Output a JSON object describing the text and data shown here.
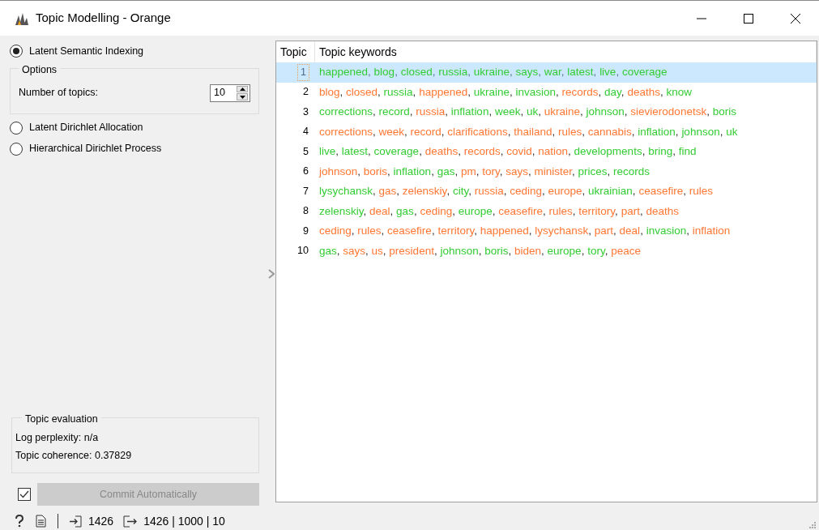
{
  "window": {
    "title": "Topic Modelling - Orange"
  },
  "methods": [
    {
      "label": "Latent Semantic Indexing",
      "selected": true
    },
    {
      "label": "Latent Dirichlet Allocation",
      "selected": false
    },
    {
      "label": "Hierarchical Dirichlet Process",
      "selected": false
    }
  ],
  "options": {
    "title": "Options",
    "label": "Number of topics:",
    "value": "10"
  },
  "evaluation": {
    "title": "Topic evaluation",
    "lines": [
      "Log perplexity: n/a",
      "Topic coherence: 0.37829"
    ]
  },
  "commit": {
    "checked": true,
    "label": "Commit Automatically",
    "disabled": true
  },
  "status_bar": {
    "input": "1426",
    "output": "1426 | 1000 | 10"
  },
  "table": {
    "columns": [
      "Topic",
      "Topic keywords"
    ],
    "separator": ", ",
    "rows": [
      {
        "topic": "1",
        "selected": true,
        "keywords": [
          {
            "text": "happened",
            "color": "#33cc33"
          },
          {
            "text": "blog",
            "color": "#33cc33"
          },
          {
            "text": "closed",
            "color": "#33cc33"
          },
          {
            "text": "russia",
            "color": "#33cc33"
          },
          {
            "text": "ukraine",
            "color": "#33cc33"
          },
          {
            "text": "says",
            "color": "#33cc33"
          },
          {
            "text": "war",
            "color": "#33cc33"
          },
          {
            "text": "latest",
            "color": "#33cc33"
          },
          {
            "text": "live",
            "color": "#33cc33"
          },
          {
            "text": "coverage",
            "color": "#33cc33"
          }
        ]
      },
      {
        "topic": "2",
        "selected": false,
        "keywords": [
          {
            "text": "blog",
            "color": "#ff7733"
          },
          {
            "text": "closed",
            "color": "#ff7733"
          },
          {
            "text": "russia",
            "color": "#33cc33"
          },
          {
            "text": "happened",
            "color": "#ff7733"
          },
          {
            "text": "ukraine",
            "color": "#33cc33"
          },
          {
            "text": "invasion",
            "color": "#33cc33"
          },
          {
            "text": "records",
            "color": "#ff7733"
          },
          {
            "text": "day",
            "color": "#33cc33"
          },
          {
            "text": "deaths",
            "color": "#ff7733"
          },
          {
            "text": "know",
            "color": "#33cc33"
          }
        ]
      },
      {
        "topic": "3",
        "selected": false,
        "keywords": [
          {
            "text": "corrections",
            "color": "#33cc33"
          },
          {
            "text": "record",
            "color": "#33cc33"
          },
          {
            "text": "russia",
            "color": "#ff7733"
          },
          {
            "text": "inflation",
            "color": "#33cc33"
          },
          {
            "text": "week",
            "color": "#33cc33"
          },
          {
            "text": "uk",
            "color": "#33cc33"
          },
          {
            "text": "ukraine",
            "color": "#ff7733"
          },
          {
            "text": "johnson",
            "color": "#33cc33"
          },
          {
            "text": "sievierodonetsk",
            "color": "#ff7733"
          },
          {
            "text": "boris",
            "color": "#33cc33"
          }
        ]
      },
      {
        "topic": "4",
        "selected": false,
        "keywords": [
          {
            "text": "corrections",
            "color": "#ff7733"
          },
          {
            "text": "week",
            "color": "#ff7733"
          },
          {
            "text": "record",
            "color": "#ff7733"
          },
          {
            "text": "clarifications",
            "color": "#ff7733"
          },
          {
            "text": "thailand",
            "color": "#ff7733"
          },
          {
            "text": "rules",
            "color": "#ff7733"
          },
          {
            "text": "cannabis",
            "color": "#ff7733"
          },
          {
            "text": "inflation",
            "color": "#33cc33"
          },
          {
            "text": "johnson",
            "color": "#33cc33"
          },
          {
            "text": "uk",
            "color": "#33cc33"
          }
        ]
      },
      {
        "topic": "5",
        "selected": false,
        "keywords": [
          {
            "text": "live",
            "color": "#33cc33"
          },
          {
            "text": "latest",
            "color": "#33cc33"
          },
          {
            "text": "coverage",
            "color": "#33cc33"
          },
          {
            "text": "deaths",
            "color": "#ff7733"
          },
          {
            "text": "records",
            "color": "#ff7733"
          },
          {
            "text": "covid",
            "color": "#ff7733"
          },
          {
            "text": "nation",
            "color": "#ff7733"
          },
          {
            "text": "developments",
            "color": "#33cc33"
          },
          {
            "text": "bring",
            "color": "#33cc33"
          },
          {
            "text": "find",
            "color": "#33cc33"
          }
        ]
      },
      {
        "topic": "6",
        "selected": false,
        "keywords": [
          {
            "text": "johnson",
            "color": "#ff7733"
          },
          {
            "text": "boris",
            "color": "#ff7733"
          },
          {
            "text": "inflation",
            "color": "#33cc33"
          },
          {
            "text": "gas",
            "color": "#33cc33"
          },
          {
            "text": "pm",
            "color": "#ff7733"
          },
          {
            "text": "tory",
            "color": "#ff7733"
          },
          {
            "text": "says",
            "color": "#ff7733"
          },
          {
            "text": "minister",
            "color": "#ff7733"
          },
          {
            "text": "prices",
            "color": "#33cc33"
          },
          {
            "text": "records",
            "color": "#33cc33"
          }
        ]
      },
      {
        "topic": "7",
        "selected": false,
        "keywords": [
          {
            "text": "lysychansk",
            "color": "#33cc33"
          },
          {
            "text": "gas",
            "color": "#ff7733"
          },
          {
            "text": "zelenskiy",
            "color": "#ff7733"
          },
          {
            "text": "city",
            "color": "#33cc33"
          },
          {
            "text": "russia",
            "color": "#ff7733"
          },
          {
            "text": "ceding",
            "color": "#ff7733"
          },
          {
            "text": "europe",
            "color": "#ff7733"
          },
          {
            "text": "ukrainian",
            "color": "#33cc33"
          },
          {
            "text": "ceasefire",
            "color": "#ff7733"
          },
          {
            "text": "rules",
            "color": "#ff7733"
          }
        ]
      },
      {
        "topic": "8",
        "selected": false,
        "keywords": [
          {
            "text": "zelenskiy",
            "color": "#33cc33"
          },
          {
            "text": "deal",
            "color": "#ff7733"
          },
          {
            "text": "gas",
            "color": "#33cc33"
          },
          {
            "text": "ceding",
            "color": "#ff7733"
          },
          {
            "text": "europe",
            "color": "#33cc33"
          },
          {
            "text": "ceasefire",
            "color": "#ff7733"
          },
          {
            "text": "rules",
            "color": "#ff7733"
          },
          {
            "text": "territory",
            "color": "#ff7733"
          },
          {
            "text": "part",
            "color": "#ff7733"
          },
          {
            "text": "deaths",
            "color": "#ff7733"
          }
        ]
      },
      {
        "topic": "9",
        "selected": false,
        "keywords": [
          {
            "text": "ceding",
            "color": "#ff7733"
          },
          {
            "text": "rules",
            "color": "#ff7733"
          },
          {
            "text": "ceasefire",
            "color": "#ff7733"
          },
          {
            "text": "territory",
            "color": "#ff7733"
          },
          {
            "text": "happened",
            "color": "#ff7733"
          },
          {
            "text": "lysychansk",
            "color": "#ff7733"
          },
          {
            "text": "part",
            "color": "#ff7733"
          },
          {
            "text": "deal",
            "color": "#ff7733"
          },
          {
            "text": "invasion",
            "color": "#33cc33"
          },
          {
            "text": "inflation",
            "color": "#ff7733"
          }
        ]
      },
      {
        "topic": "10",
        "selected": false,
        "keywords": [
          {
            "text": "gas",
            "color": "#33cc33"
          },
          {
            "text": "says",
            "color": "#ff7733"
          },
          {
            "text": "us",
            "color": "#ff7733"
          },
          {
            "text": "president",
            "color": "#ff7733"
          },
          {
            "text": "johnson",
            "color": "#33cc33"
          },
          {
            "text": "boris",
            "color": "#33cc33"
          },
          {
            "text": "biden",
            "color": "#ff7733"
          },
          {
            "text": "europe",
            "color": "#33cc33"
          },
          {
            "text": "tory",
            "color": "#33cc33"
          },
          {
            "text": "peace",
            "color": "#ff7733"
          }
        ]
      }
    ]
  }
}
